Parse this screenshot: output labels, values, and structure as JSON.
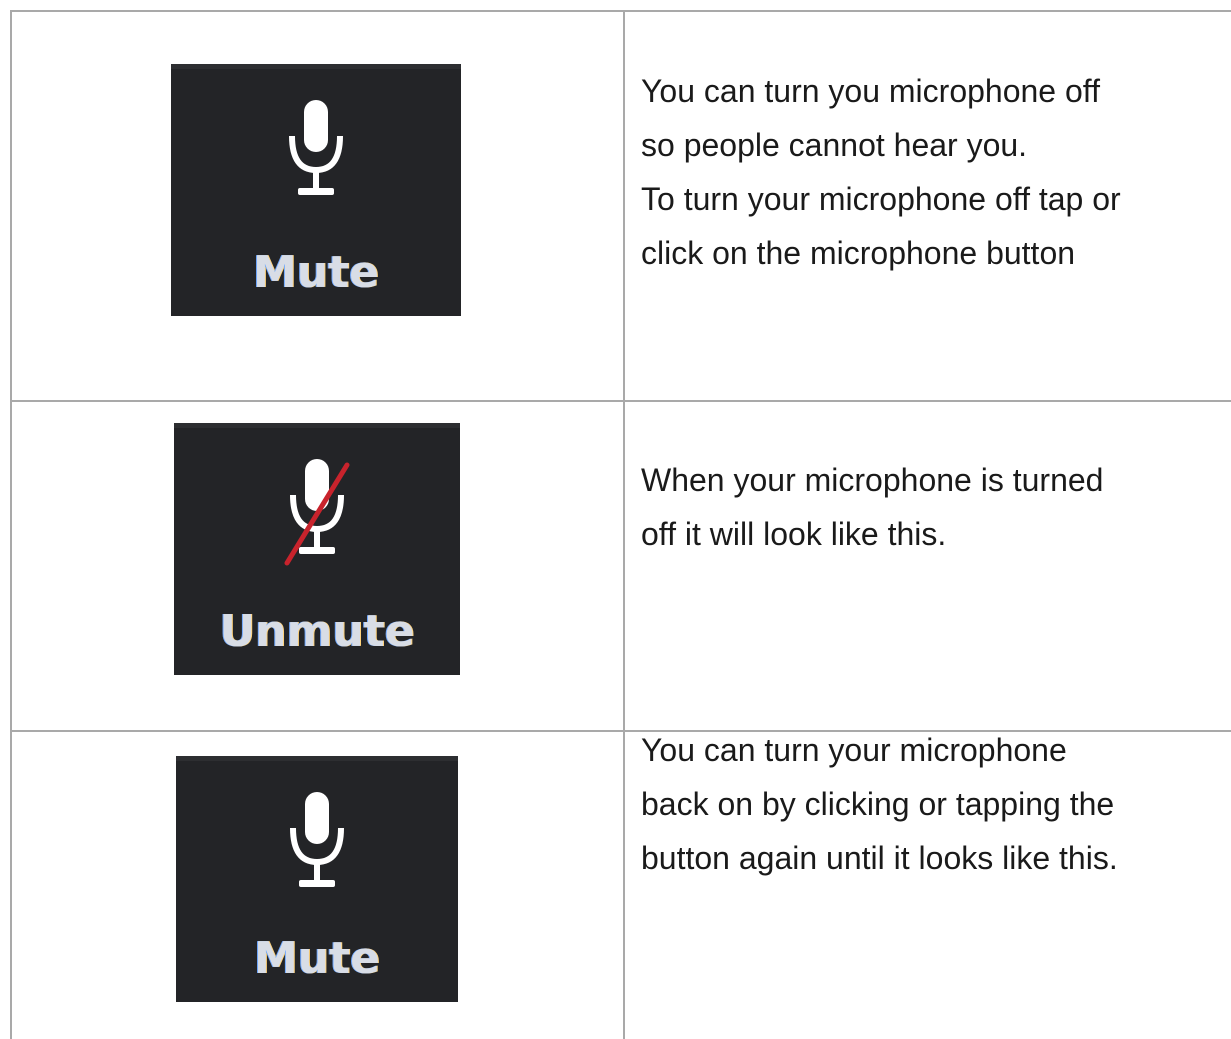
{
  "rows": [
    {
      "button_label": "Mute",
      "button_state": "unmuted",
      "icon": "microphone-icon",
      "description": [
        "You can turn you microphone off",
        "so people cannot hear you.",
        "To turn your microphone off tap or",
        "click on the microphone button"
      ]
    },
    {
      "button_label": "Unmute",
      "button_state": "muted",
      "icon": "microphone-muted-icon",
      "description": [
        "When your microphone is turned",
        "off it will look like this."
      ]
    },
    {
      "button_label": "Mute",
      "button_state": "unmuted",
      "icon": "microphone-icon",
      "description": [
        "You can turn your microphone",
        "back on by clicking or tapping the",
        "button again until it looks like this."
      ]
    }
  ],
  "colors": {
    "button_bg": "#232427",
    "icon": "#ffffff",
    "strike": "#c8232c",
    "border": "#a9a9a9",
    "text": "#1a1a1a"
  }
}
